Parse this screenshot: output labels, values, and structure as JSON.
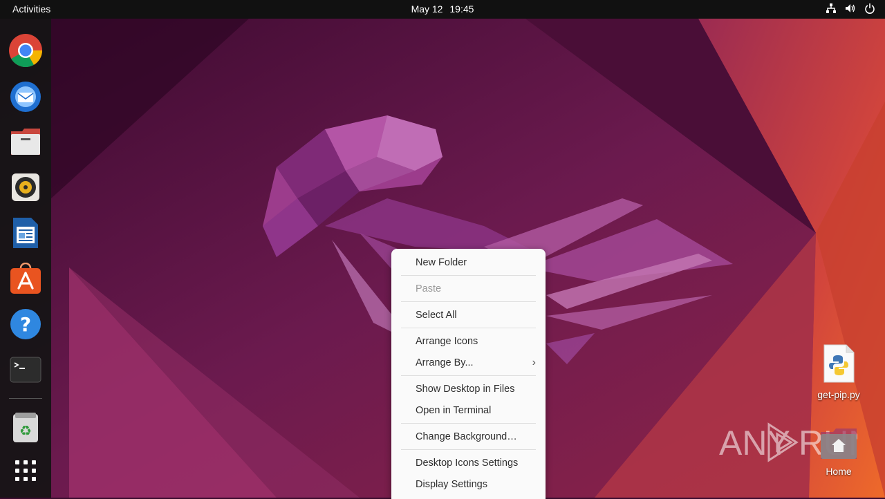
{
  "topbar": {
    "activities": "Activities",
    "date": "May 12",
    "time": "19:45",
    "tray_icons": [
      "network-icon",
      "volume-icon",
      "power-icon"
    ]
  },
  "dock": {
    "apps": [
      {
        "name": "Google Chrome",
        "icon": "chrome-icon"
      },
      {
        "name": "Thunderbird Mail",
        "icon": "thunderbird-icon"
      },
      {
        "name": "Files",
        "icon": "files-icon"
      },
      {
        "name": "Rhythmbox",
        "icon": "rhythmbox-icon"
      },
      {
        "name": "LibreOffice Writer",
        "icon": "writer-icon"
      },
      {
        "name": "Ubuntu Software",
        "icon": "software-icon"
      },
      {
        "name": "Help",
        "icon": "help-icon"
      },
      {
        "name": "Terminal",
        "icon": "terminal-icon"
      },
      {
        "name": "Trash",
        "icon": "trash-icon"
      },
      {
        "name": "Show Applications",
        "icon": "app-grid-icon"
      }
    ]
  },
  "desktop_icons": [
    {
      "label": "get-pip.py",
      "icon": "python-file-icon"
    },
    {
      "label": "Home",
      "icon": "home-folder-icon"
    }
  ],
  "watermark": {
    "text": "ANY RUN"
  },
  "context_menu": {
    "items": [
      {
        "label": "New Folder",
        "enabled": true
      },
      {
        "label": "Paste",
        "enabled": false
      },
      {
        "label": "Select All",
        "enabled": true
      },
      {
        "label": "Arrange Icons",
        "enabled": true
      },
      {
        "label": "Arrange By...",
        "enabled": true,
        "submenu": true
      },
      {
        "label": "Show Desktop in Files",
        "enabled": true
      },
      {
        "label": "Open in Terminal",
        "enabled": true
      },
      {
        "label": "Change Background…",
        "enabled": true
      },
      {
        "label": "Desktop Icons Settings",
        "enabled": true
      },
      {
        "label": "Display Settings",
        "enabled": true
      }
    ]
  },
  "colors": {
    "topbar": "#111111",
    "dock": "#141414",
    "menu_bg": "#fafafa",
    "wallpaper_dark": "#3a0b2e",
    "wallpaper_orange": "#e8562a"
  }
}
